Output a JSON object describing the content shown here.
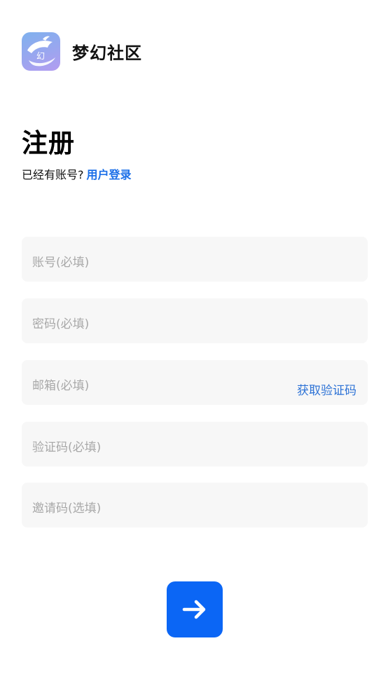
{
  "app": {
    "name": "梦幻社区",
    "logo_icon": "dolphin-logo-icon",
    "logo_glyph": "幻"
  },
  "register": {
    "title": "注册",
    "have_account_text": "已经有账号?",
    "login_link": "用户登录"
  },
  "fields": {
    "account_placeholder": "账号(必填)",
    "password_placeholder": "密码(必填)",
    "email_placeholder": "邮箱(必填)",
    "get_code_label": "获取验证码",
    "code_placeholder": "验证码(必填)",
    "invite_placeholder": "邀请码(选填)"
  },
  "submit": {
    "icon": "arrow-right-icon",
    "color": "#0b66f5"
  },
  "colors": {
    "link": "#1b6fe8",
    "field_bg": "#f7f7f7",
    "placeholder": "#a8a8a8"
  }
}
